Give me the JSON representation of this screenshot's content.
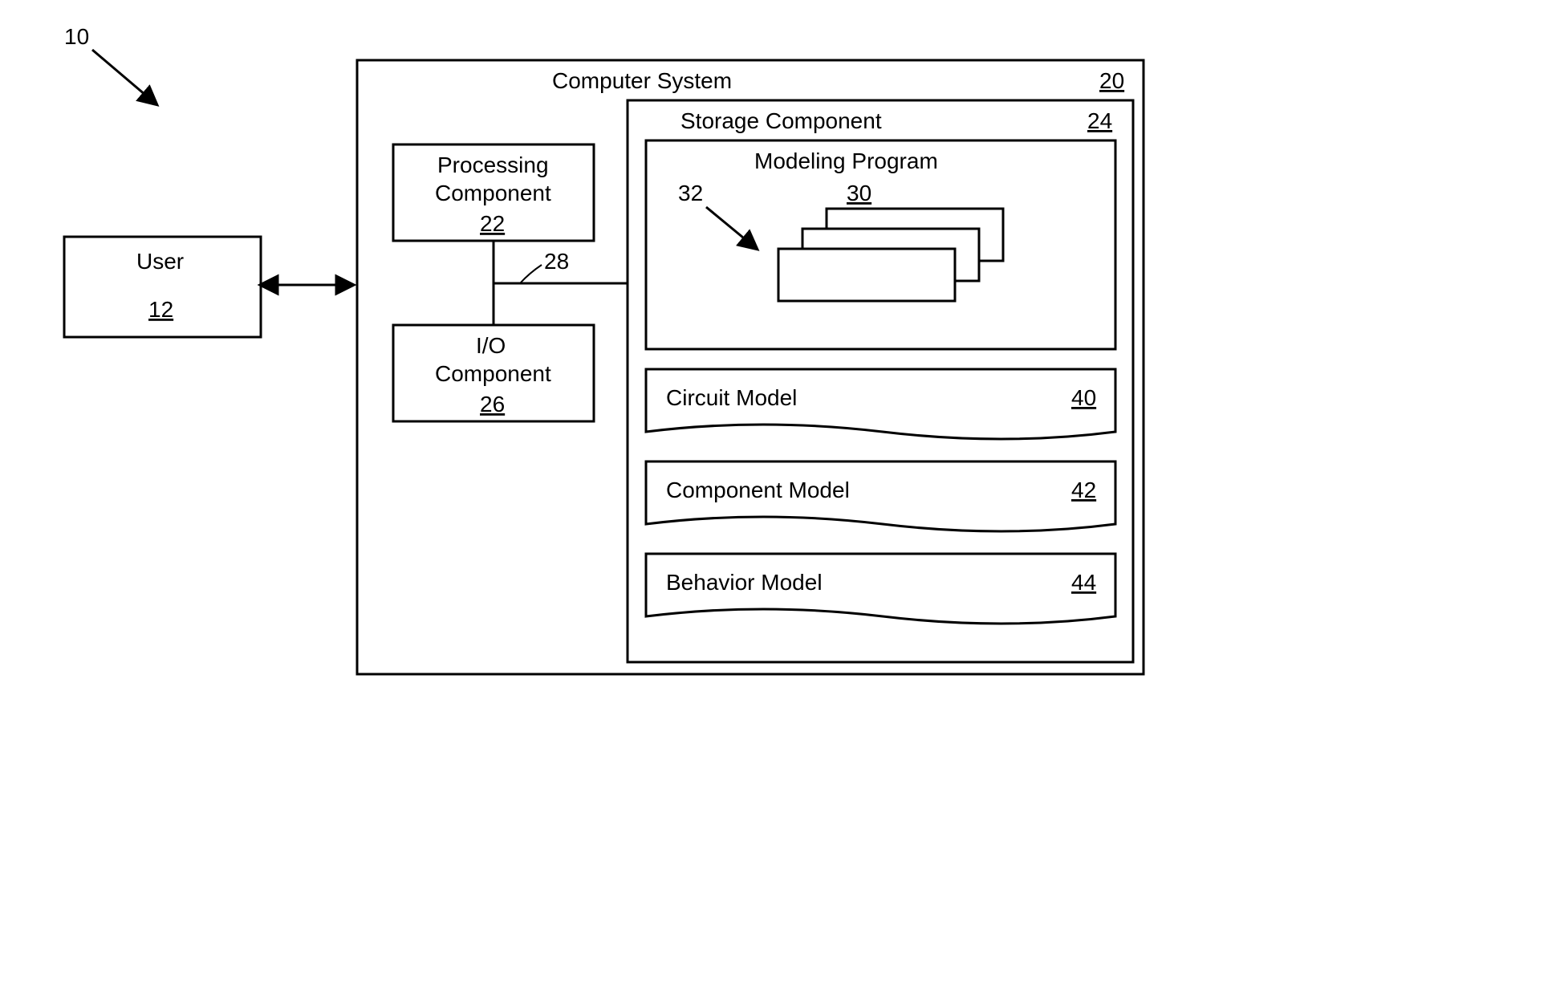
{
  "figure": {
    "ref": "10"
  },
  "user": {
    "label": "User",
    "ref": "12"
  },
  "computerSystem": {
    "label": "Computer System",
    "ref": "20"
  },
  "processing": {
    "line1": "Processing",
    "line2": "Component",
    "ref": "22"
  },
  "io": {
    "line1": "I/O",
    "line2": "Component",
    "ref": "26"
  },
  "bus": {
    "ref": "28"
  },
  "storage": {
    "label": "Storage Component",
    "ref": "24"
  },
  "modelingProgram": {
    "label": "Modeling Program",
    "ref": "30",
    "stackRef": "32"
  },
  "circuitModel": {
    "label": "Circuit Model",
    "ref": "40"
  },
  "componentModel": {
    "label": "Component Model",
    "ref": "42"
  },
  "behaviorModel": {
    "label": "Behavior Model",
    "ref": "44"
  }
}
